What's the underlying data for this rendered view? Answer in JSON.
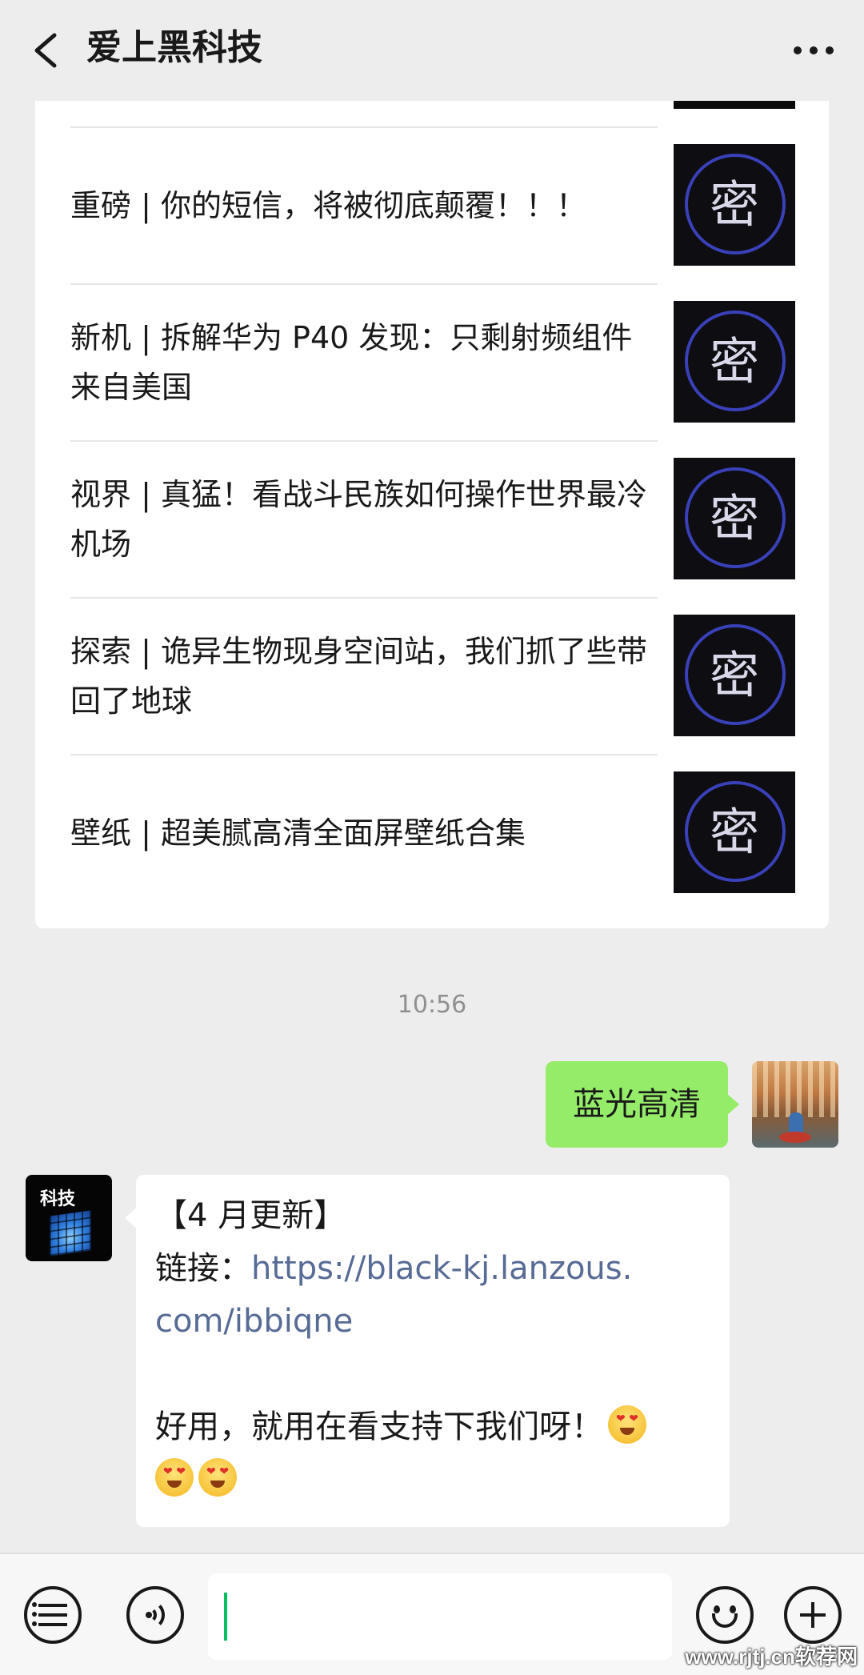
{
  "header": {
    "title": "爱上黑科技"
  },
  "articles": [
    {
      "title": "重磅 | 你的短信，将被彻底颠覆！！！",
      "thumb_char": "密"
    },
    {
      "title": "新机 | 拆解华为 P40 发现：只剩射频组件来自美国",
      "thumb_char": "密"
    },
    {
      "title": "视界 | 真猛！看战斗民族如何操作世界最冷机场",
      "thumb_char": "密"
    },
    {
      "title": "探索 | 诡异生物现身空间站，我们抓了些带回了地球",
      "thumb_char": "密"
    },
    {
      "title": "壁纸 | 超美腻高清全面屏壁纸合集",
      "thumb_char": "密"
    }
  ],
  "chat": {
    "timestamp": "10:56",
    "outgoing_message": "蓝光高清",
    "incoming": {
      "avatar_label": "科技",
      "line1": "【4 月更新】",
      "link_prefix": "链接：",
      "link_part1": "https://black-kj.lanzous.",
      "link_part2": "com/ibbiqne",
      "line3": "好用，就用在看支持下我们呀！"
    }
  },
  "input_bar": {
    "placeholder": "",
    "value": ""
  },
  "watermark": "www.rjtj.cn软荐网",
  "colors": {
    "outgoing_bubble": "#95ec69",
    "link": "#576b95",
    "caret": "#07c160",
    "background": "#ededed"
  }
}
